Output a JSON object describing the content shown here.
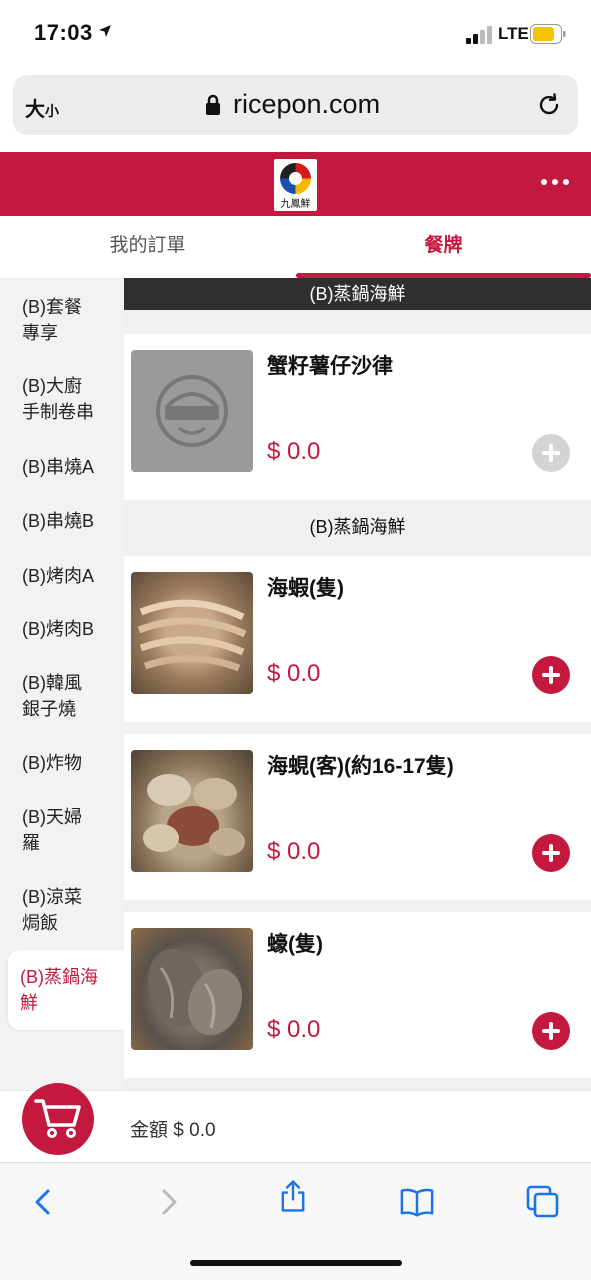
{
  "status": {
    "time": "17:03",
    "network": "LTE"
  },
  "browser": {
    "text_size_label": "大",
    "text_size_small": "小",
    "url": "ricepon.com"
  },
  "header": {
    "logo_text": "九鳳鮮"
  },
  "tabs": [
    {
      "label": "我的訂單"
    },
    {
      "label": "餐牌"
    }
  ],
  "sidebar": {
    "items": [
      {
        "label": "(B)套餐\n專享"
      },
      {
        "label": "(B)大廚\n手制卷串"
      },
      {
        "label": "(B)串燒A"
      },
      {
        "label": "(B)串燒B"
      },
      {
        "label": "(B)烤肉A"
      },
      {
        "label": "(B)烤肉B"
      },
      {
        "label": "(B)韓風\n銀子燒"
      },
      {
        "label": "(B)炸物"
      },
      {
        "label": "(B)天婦\n羅"
      },
      {
        "label": "(B)涼菜\n焗飯"
      },
      {
        "label": "(B)蒸鍋海\n鮮"
      }
    ]
  },
  "menu": {
    "section_top": "(B)蒸鍋海鮮",
    "section_second": "(B)蒸鍋海鮮",
    "products": [
      {
        "name": "蟹籽薯仔沙律",
        "price": "$ 0.0"
      },
      {
        "name": "海蝦(隻)",
        "price": "$ 0.0"
      },
      {
        "name": "海蜆(客)(約16-17隻)",
        "price": "$ 0.0"
      },
      {
        "name": "蠔(隻)",
        "price": "$ 0.0"
      }
    ]
  },
  "cart": {
    "amount_label": "金額 $ 0.0"
  },
  "colors": {
    "brand": "#c3193f"
  }
}
